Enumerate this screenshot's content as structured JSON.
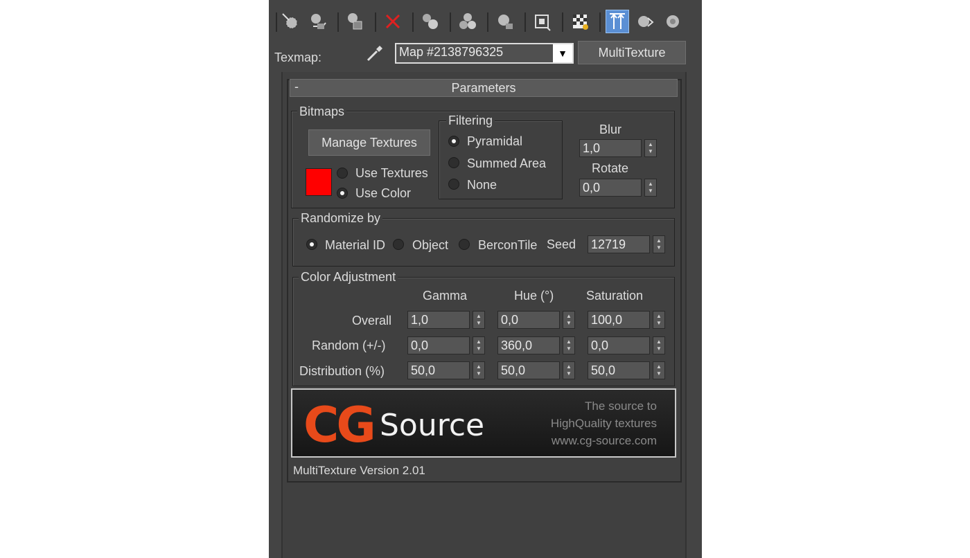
{
  "toolbar": {
    "icons": [
      "get-material-icon",
      "put-to-scene-icon",
      "assign-to-selection-icon",
      "reset-map-icon",
      "make-unique-icon",
      "put-to-library-icon",
      "material-id-channel-icon",
      "show-shaded-in-viewport-icon",
      "show-background-icon",
      "show-end-result-icon",
      "go-to-parent-icon",
      "go-forward-to-sibling-icon"
    ]
  },
  "texmap": {
    "label": "Texmap:",
    "map_name": "Map #2138796325",
    "type_button": "MultiTexture"
  },
  "rollout": {
    "collapse": "-",
    "title": "Parameters"
  },
  "bitmaps": {
    "title": "Bitmaps",
    "manage_button": "Manage Textures",
    "use_textures": "Use Textures",
    "use_color": "Use Color",
    "selected": "use_color",
    "swatch_color": "#ff0000"
  },
  "filtering": {
    "title": "Filtering",
    "pyramidal": "Pyramidal",
    "summed_area": "Summed Area",
    "none": "None",
    "selected": "pyramidal"
  },
  "blur": {
    "label": "Blur",
    "value": "1,0"
  },
  "rotate": {
    "label": "Rotate",
    "value": "0,0"
  },
  "randomize": {
    "title": "Randomize by",
    "material_id": "Material ID",
    "object": "Object",
    "bercontile": "BerconTile",
    "selected": "material_id",
    "seed_label": "Seed",
    "seed_value": "12719"
  },
  "color_adjustment": {
    "title": "Color Adjustment",
    "col_gamma": "Gamma",
    "col_hue": "Hue (°)",
    "col_saturation": "Saturation",
    "overall": {
      "label": "Overall",
      "gamma": "1,0",
      "hue": "0,0",
      "saturation": "100,0"
    },
    "random": {
      "label": "Random (+/-)",
      "gamma": "0,0",
      "hue": "360,0",
      "saturation": "0,0"
    },
    "distribution": {
      "label": "Distribution (%)",
      "gamma": "50,0",
      "hue": "50,0",
      "saturation": "50,0"
    }
  },
  "logo": {
    "cg": "CG",
    "source": "Source",
    "tagline1": "The source to",
    "tagline2": "HighQuality textures",
    "tagline3": "www.cg-source.com"
  },
  "version": "MultiTexture Version 2.01"
}
